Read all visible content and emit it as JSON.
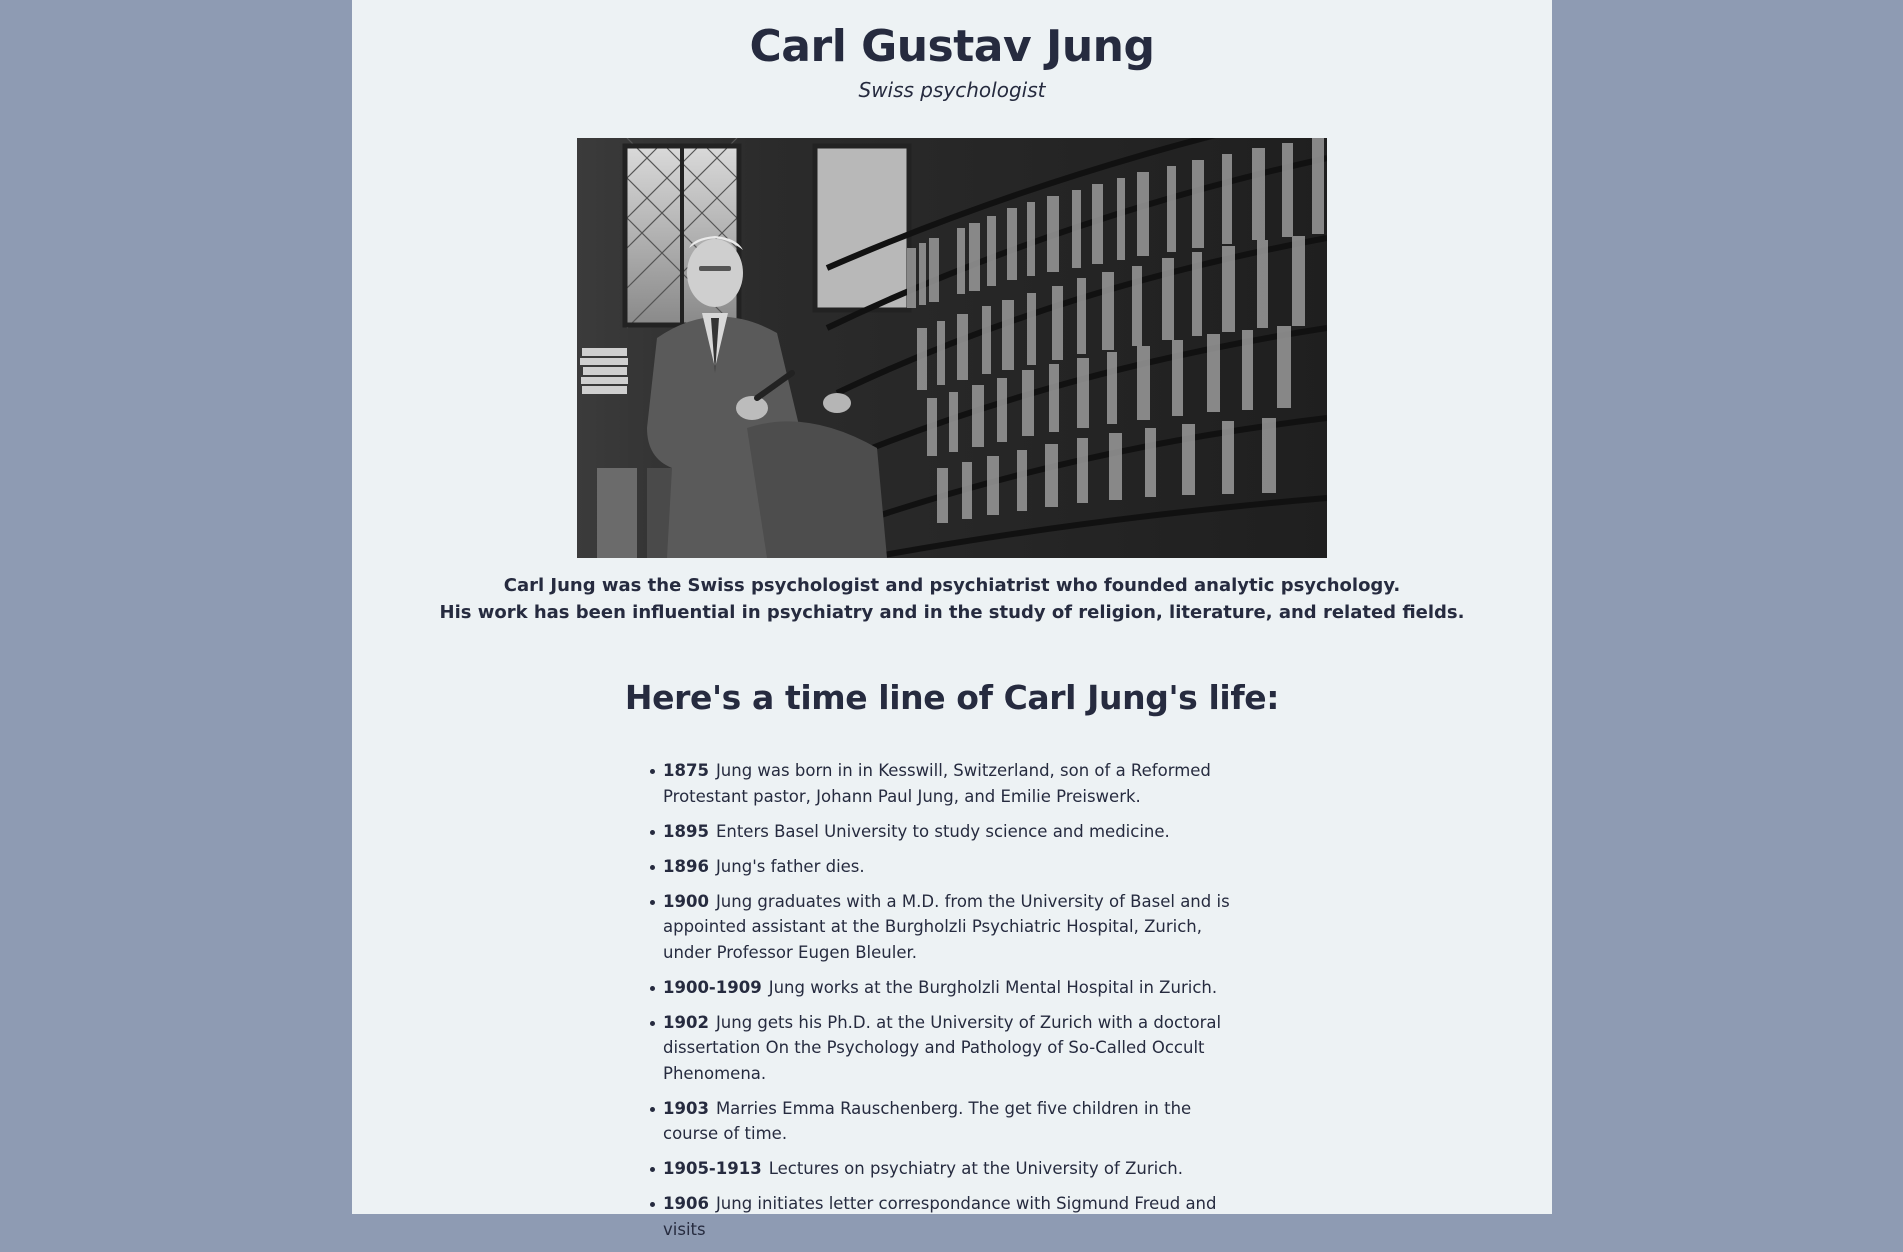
{
  "header": {
    "title": "Carl Gustav Jung",
    "subtitle": "Swiss psychologist"
  },
  "figure": {
    "alt": "Carl Jung seated with a pipe beside bookshelves"
  },
  "caption": {
    "line1": "Carl Jung was the Swiss psychologist and psychiatrist who founded analytic psychology.",
    "line2": "His work has been influential in psychiatry and in the study of religion, literature, and related fields."
  },
  "timeline": {
    "heading": "Here's a time line of Carl Jung's life:",
    "items": [
      {
        "year": "1875",
        "text": "Jung was born in in Kesswill, Switzerland, son of a Reformed Protestant pastor, Johann Paul Jung, and Emilie Preiswerk."
      },
      {
        "year": "1895",
        "text": "Enters Basel University to study science and medicine."
      },
      {
        "year": "1896",
        "text": "Jung's father dies."
      },
      {
        "year": "1900",
        "text": "Jung graduates with a M.D. from the University of Basel and is appointed assistant at the Burgholzli Psychiatric Hospital, Zurich, under Professor Eugen Bleuler."
      },
      {
        "year": "1900-1909",
        "text": "Jung works at the Burgholzli Mental Hospital in Zurich."
      },
      {
        "year": "1902",
        "text": "Jung gets his Ph.D. at the University of Zurich with a doctoral dissertation On the Psychology and Pathology of So-Called Occult Phenomena."
      },
      {
        "year": "1903",
        "text": "Marries Emma Rauschenberg. The get five children in the course of time."
      },
      {
        "year": "1905-1913",
        "text": "Lectures on psychiatry at the University of Zurich."
      },
      {
        "year": "1906",
        "text": "Jung initiates letter correspondance with Sigmund Freud and visits"
      }
    ]
  }
}
